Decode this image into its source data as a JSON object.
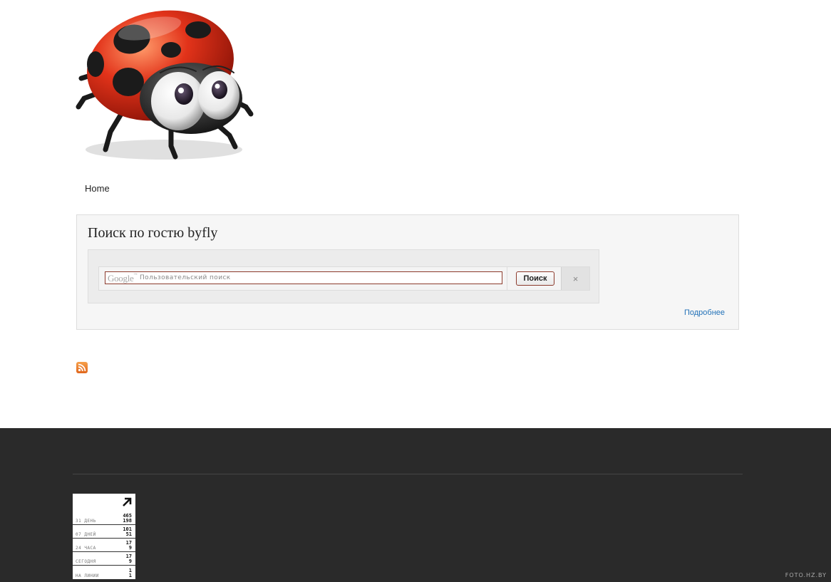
{
  "nav": {
    "home": "Home"
  },
  "search_panel": {
    "title": "Поиск по гостю byfly",
    "google_logo": "Google",
    "google_tm": "™",
    "placeholder": "Пользовательский поиск",
    "search_button": "Поиск",
    "clear_icon": "×",
    "more_link": "Подробнее"
  },
  "counter": {
    "rows": [
      {
        "label": "31 ДЕНЬ",
        "v1": "465",
        "v2": "198"
      },
      {
        "label": "07 ДНЕЙ",
        "v1": "101",
        "v2": "51"
      },
      {
        "label": "24 ЧАСА",
        "v1": "17",
        "v2": "9"
      },
      {
        "label": "СЕГОДНЯ",
        "v1": "17",
        "v2": "9"
      },
      {
        "label": "НА ЛИНИИ",
        "v1": "1",
        "v2": "1"
      }
    ]
  },
  "icons": {
    "logo": "ladybug-logo-icon",
    "rss": "rss-icon",
    "counter_arrow": "arrow-up-right-icon",
    "clear": "close-icon"
  },
  "watermark": "FOTO.HZ.BY"
}
